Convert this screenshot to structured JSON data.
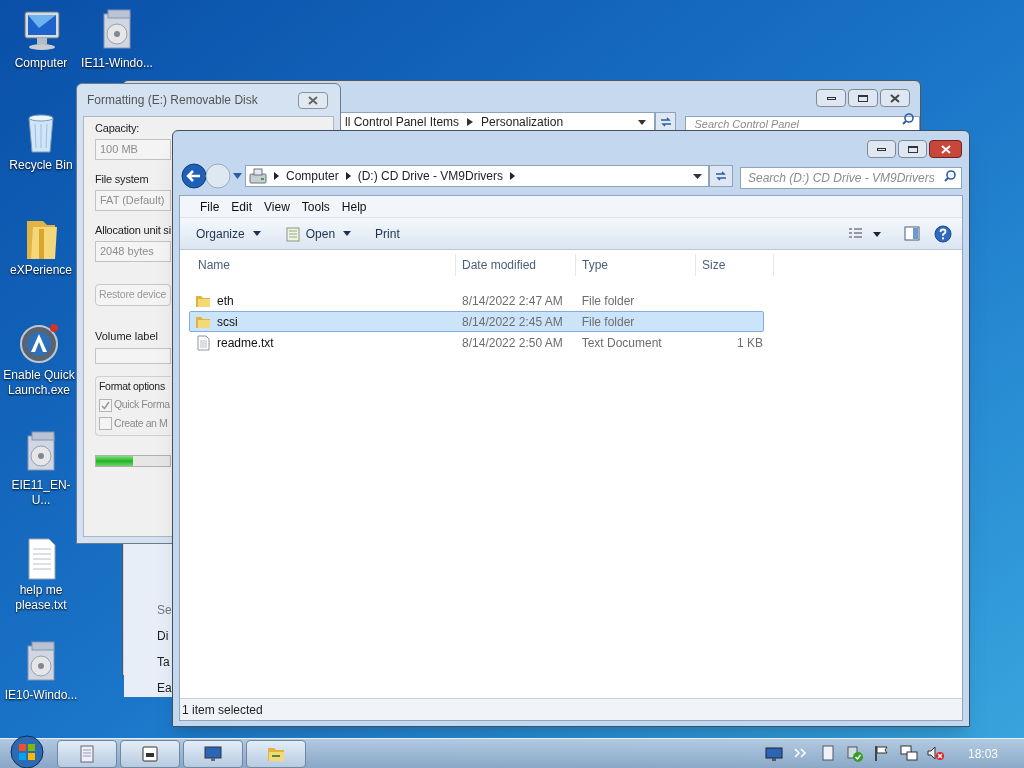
{
  "desktop_icons": [
    {
      "label": "Computer",
      "kind": "computer"
    },
    {
      "label": "IE11-Windo...",
      "kind": "installer"
    },
    {
      "label": "Recycle Bin",
      "kind": "recycle"
    },
    {
      "label": "eXPerience",
      "kind": "folder"
    },
    {
      "label": "Enable Quick Launch.exe",
      "kind": "app"
    },
    {
      "label": "EIE11_EN-U...",
      "kind": "installer"
    },
    {
      "label": "help me please.txt",
      "kind": "textfile"
    },
    {
      "label": "IE10-Windo...",
      "kind": "installer"
    }
  ],
  "control_panel_window": {
    "address": [
      "ll Control Panel Items",
      "Personalization"
    ],
    "search": {
      "placeholder": "Search Control Panel"
    },
    "side_links": [
      {
        "label": "Se",
        "kind": "heading"
      },
      {
        "label": "Di",
        "kind": "link"
      },
      {
        "label": "Ta",
        "kind": "link"
      },
      {
        "label": "Ea",
        "kind": "link"
      }
    ]
  },
  "format_dialog": {
    "title": "Formatting (E:) Removable Disk",
    "fields": [
      {
        "label": "Capacity:",
        "value": "100 MB"
      },
      {
        "label": "File system",
        "value": "FAT (Default)"
      },
      {
        "label": "Allocation unit si",
        "value": "2048 bytes"
      }
    ],
    "restore_button": "Restore device",
    "volume_label": {
      "label": "Volume label"
    },
    "format_options": {
      "label": "Format options",
      "options": [
        {
          "label": "Quick Forma",
          "checked": true
        },
        {
          "label": "Create an M",
          "checked": false
        }
      ]
    },
    "progress": {
      "level": 0.5
    }
  },
  "explorer": {
    "breadcrumb": [
      "Computer",
      "(D:) CD Drive - VM9Drivers"
    ],
    "search": {
      "placeholder": "Search (D:) CD Drive - VM9Drivers"
    },
    "menu": [
      "File",
      "Edit",
      "View",
      "Tools",
      "Help"
    ],
    "toolbar": [
      {
        "label": "Organize",
        "kind": "dropdown"
      },
      {
        "label": "Open",
        "kind": "icon-dropdown"
      },
      {
        "label": "Print",
        "kind": "plain"
      }
    ],
    "columns": [
      "Name",
      "Date modified",
      "Type",
      "Size"
    ],
    "rows": [
      {
        "name": "eth",
        "date": "8/14/2022 2:47 AM",
        "type": "File folder",
        "size": "",
        "kind": "folder",
        "selected": false
      },
      {
        "name": "scsi",
        "date": "8/14/2022 2:45 AM",
        "type": "File folder",
        "size": "",
        "kind": "folder",
        "selected": true
      },
      {
        "name": "readme.txt",
        "date": "8/14/2022 2:50 AM",
        "type": "Text Document",
        "size": "1 KB",
        "kind": "file",
        "selected": false
      }
    ],
    "status": "1 item selected"
  },
  "taskbar": {
    "buttons": [
      {
        "kind": "document"
      },
      {
        "kind": "disk"
      },
      {
        "kind": "monitor"
      },
      {
        "kind": "folder"
      }
    ],
    "tray": [
      {
        "kind": "monitor"
      },
      {
        "kind": "chevron"
      },
      {
        "kind": "document"
      },
      {
        "kind": "shield"
      },
      {
        "kind": "flag"
      },
      {
        "kind": "network"
      },
      {
        "kind": "speaker-muted"
      }
    ],
    "clock": "18:03"
  }
}
